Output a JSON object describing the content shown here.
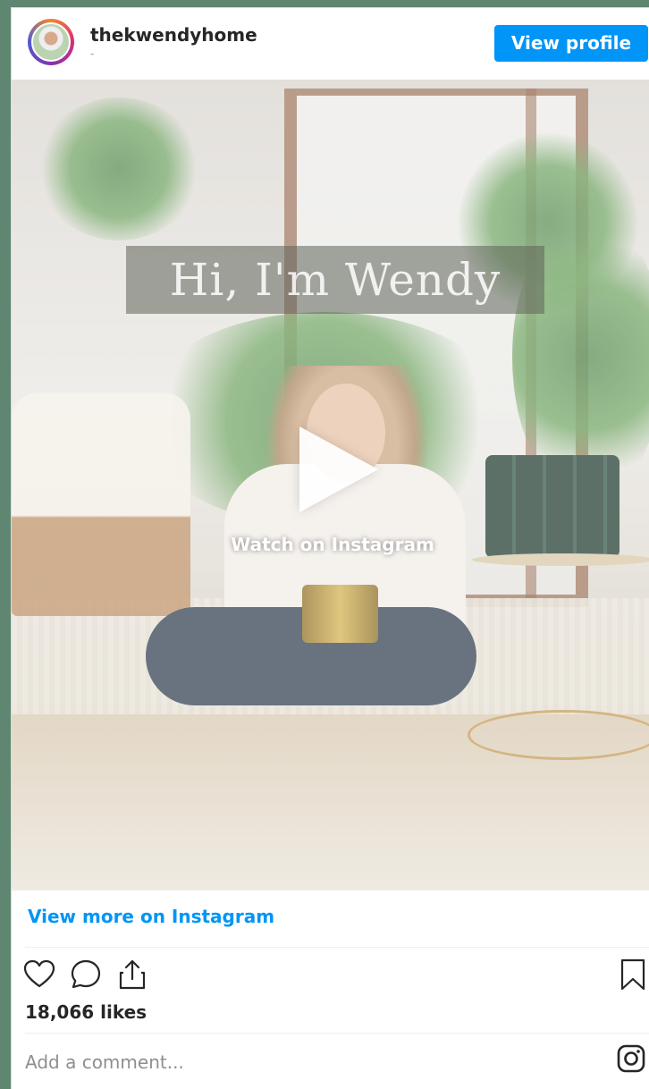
{
  "header": {
    "username": "thekwendyhome",
    "subline": "-",
    "view_profile_label": "View profile"
  },
  "media": {
    "title_overlay": "Hi, I'm Wendy",
    "watch_label": "Watch on Instagram",
    "play_icon": "play-icon"
  },
  "footer": {
    "view_more_label": "View more on Instagram",
    "likes": "18,066 likes",
    "comment_placeholder": "Add a comment...",
    "icons": [
      "heart-icon",
      "comment-icon",
      "share-icon",
      "bookmark-icon",
      "instagram-icon"
    ]
  },
  "colors": {
    "accent": "#0095f6",
    "page_background": "#5f8670"
  }
}
